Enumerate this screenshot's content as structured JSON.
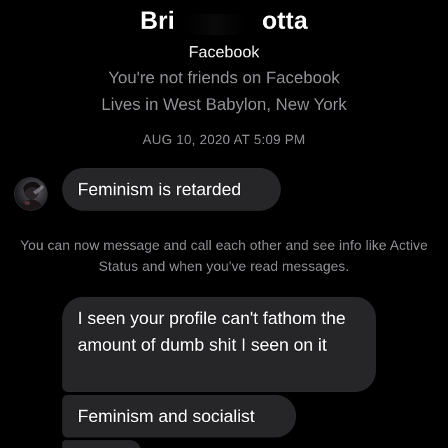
{
  "header": {
    "name": "Bri       otta",
    "platform": "Facebook",
    "friend_status": "You're not friends on Facebook",
    "location": "Lives in West Babylon, New York"
  },
  "thread": {
    "timestamp": "AUG 10, 2020 AT 5:09 PM",
    "messages": [
      {
        "text": "Feminism is retarded"
      },
      {
        "text": "I seen your profile can't fathom the amount of dumb shit I seen on it"
      },
      {
        "text": "Feminism and socialist"
      },
      {
        "text": ""
      }
    ],
    "notice": "You can now message and call each other and see info like Active Status and when you've read messages."
  },
  "colors": {
    "background": "#000000",
    "bubble": "#262628",
    "secondary_text": "#8e8e93"
  },
  "icons": {
    "avatar": "contact-avatar-photo"
  }
}
